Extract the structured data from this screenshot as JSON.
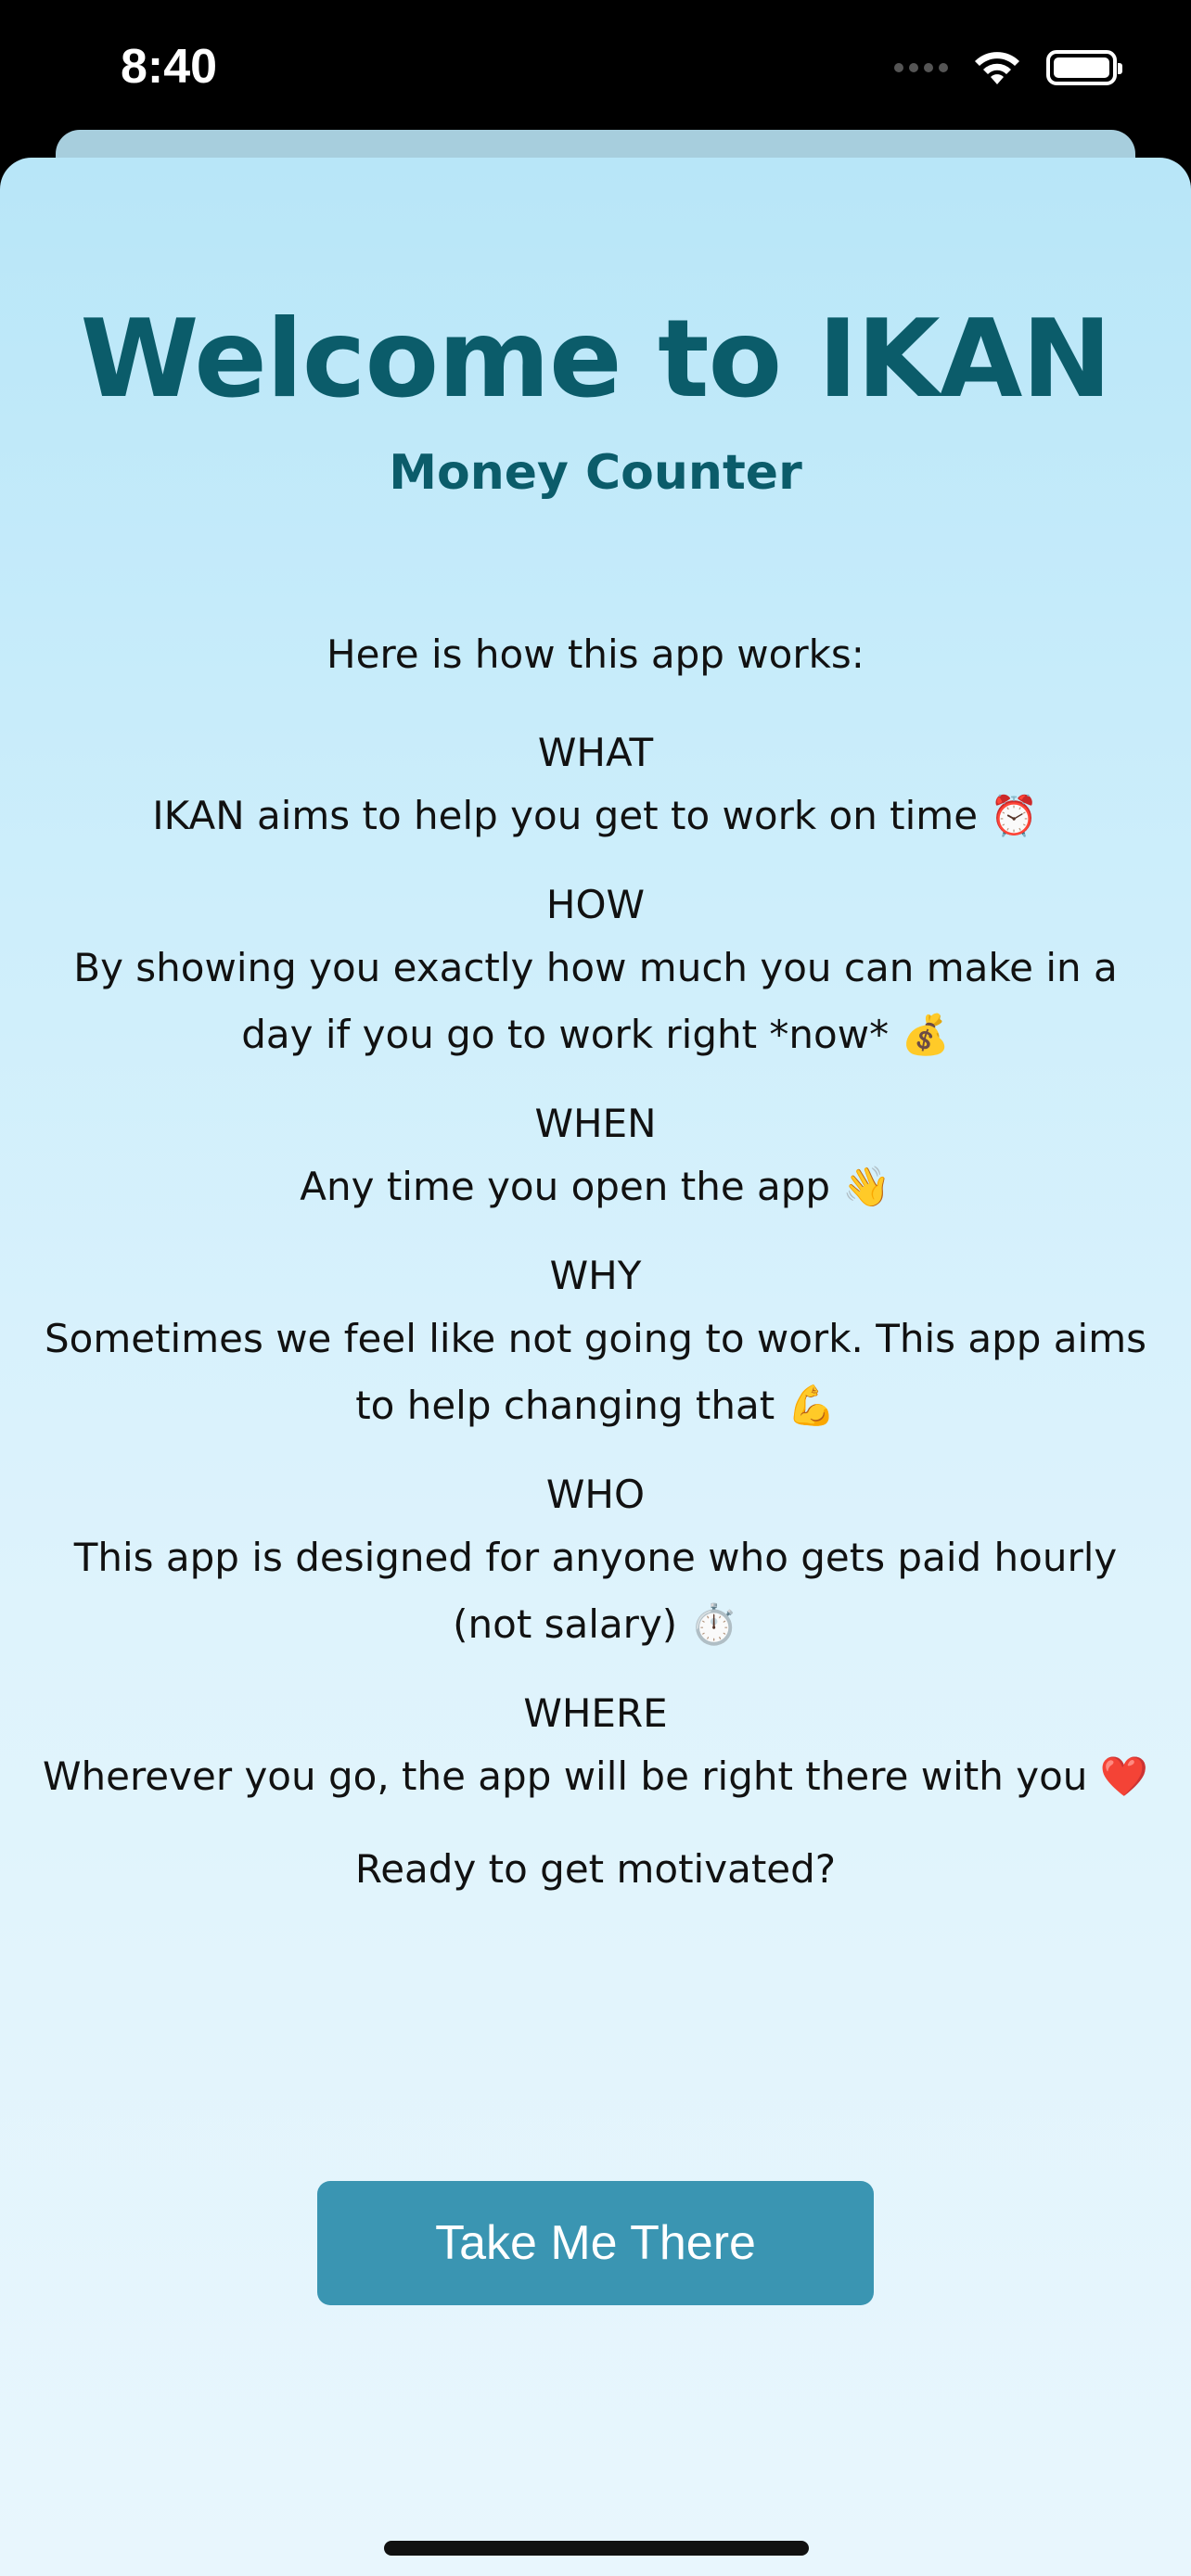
{
  "status_bar": {
    "time": "8:40"
  },
  "welcome": {
    "title": "Welcome to IKAN",
    "subtitle": "Money Counter",
    "intro": "Here is how this app works:",
    "sections": [
      {
        "heading": "WHAT",
        "text": "IKAN aims to help you get to work on time ⏰"
      },
      {
        "heading": "HOW",
        "text": "By showing you exactly how much you can make in a day if you go to work right *now* 💰"
      },
      {
        "heading": "WHEN",
        "text": "Any time you open the app 👋"
      },
      {
        "heading": "WHY",
        "text": "Sometimes we feel like not going to work. This app aims to help changing that 💪"
      },
      {
        "heading": "WHO",
        "text": "This app is designed for anyone who gets paid hourly (not salary) ⏱️"
      },
      {
        "heading": "WHERE",
        "text": "Wherever you go, the app will be right there with you ❤️"
      }
    ],
    "closing": "Ready to get motivated?",
    "cta_label": "Take Me There"
  },
  "colors": {
    "title": "#0b5c6a",
    "button": "#3a95b2",
    "background_top": "#b8e6f8",
    "background_bottom": "#e8f6fd"
  }
}
